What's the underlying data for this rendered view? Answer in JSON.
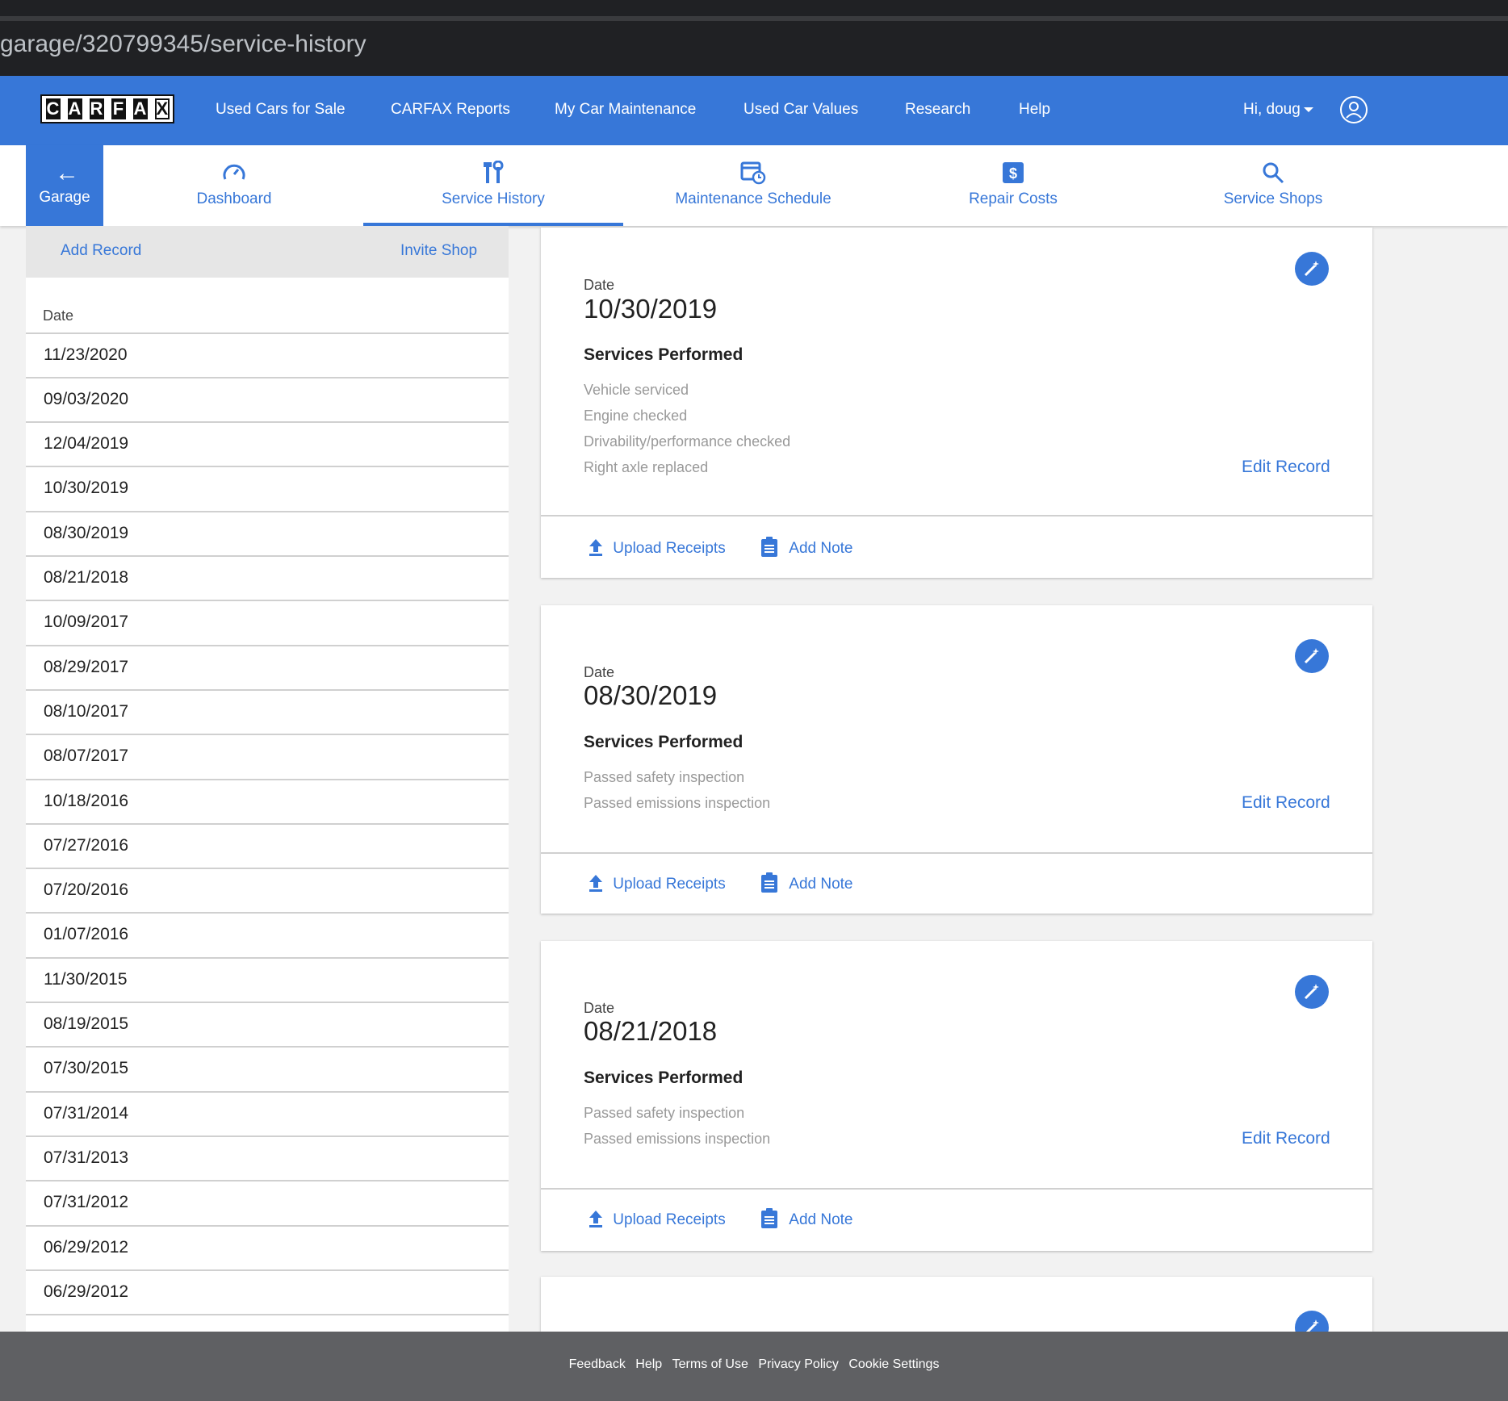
{
  "browser": {
    "url": "garage/320799345/service-history"
  },
  "header": {
    "logo_letters": [
      "C",
      "A",
      "R",
      "F",
      "A",
      "X"
    ],
    "nav": [
      "Used Cars for Sale",
      "CARFAX Reports",
      "My Car Maintenance",
      "Used Car Values",
      "Research",
      "Help"
    ],
    "user_greeting": "Hi, doug",
    "brand_color": "#3777d8"
  },
  "subnav": {
    "back_label": "Garage",
    "tabs": [
      {
        "label": "Dashboard",
        "icon": "speedometer-icon"
      },
      {
        "label": "Service History",
        "icon": "wrench-icon",
        "active": true
      },
      {
        "label": "Maintenance Schedule",
        "icon": "calendar-clock-icon"
      },
      {
        "label": "Repair Costs",
        "icon": "dollar-icon"
      },
      {
        "label": "Service Shops",
        "icon": "search-icon"
      }
    ]
  },
  "left_panel": {
    "add_record": "Add Record",
    "invite_shop": "Invite Shop",
    "date_header": "Date",
    "dates": [
      "11/23/2020",
      "09/03/2020",
      "12/04/2019",
      "10/30/2019",
      "08/30/2019",
      "08/21/2018",
      "10/09/2017",
      "08/29/2017",
      "08/10/2017",
      "08/07/2017",
      "10/18/2016",
      "07/27/2016",
      "07/20/2016",
      "01/07/2016",
      "11/30/2015",
      "08/19/2015",
      "07/30/2015",
      "07/31/2014",
      "07/31/2013",
      "07/31/2012",
      "06/29/2012",
      "06/29/2012"
    ]
  },
  "records": {
    "date_label": "Date",
    "services_label": "Services Performed",
    "edit_label": "Edit Record",
    "upload_label": "Upload Receipts",
    "note_label": "Add Note",
    "items": [
      {
        "date": "10/30/2019",
        "services": [
          "Vehicle serviced",
          "Engine checked",
          "Drivability/performance checked",
          "Right axle replaced"
        ]
      },
      {
        "date": "08/30/2019",
        "services": [
          "Passed safety inspection",
          "Passed emissions inspection"
        ]
      },
      {
        "date": "08/21/2018",
        "services": [
          "Passed safety inspection",
          "Passed emissions inspection"
        ]
      }
    ]
  },
  "footer": {
    "links": [
      "Feedback",
      "Help",
      "Terms of Use",
      "Privacy Policy",
      "Cookie Settings"
    ]
  }
}
